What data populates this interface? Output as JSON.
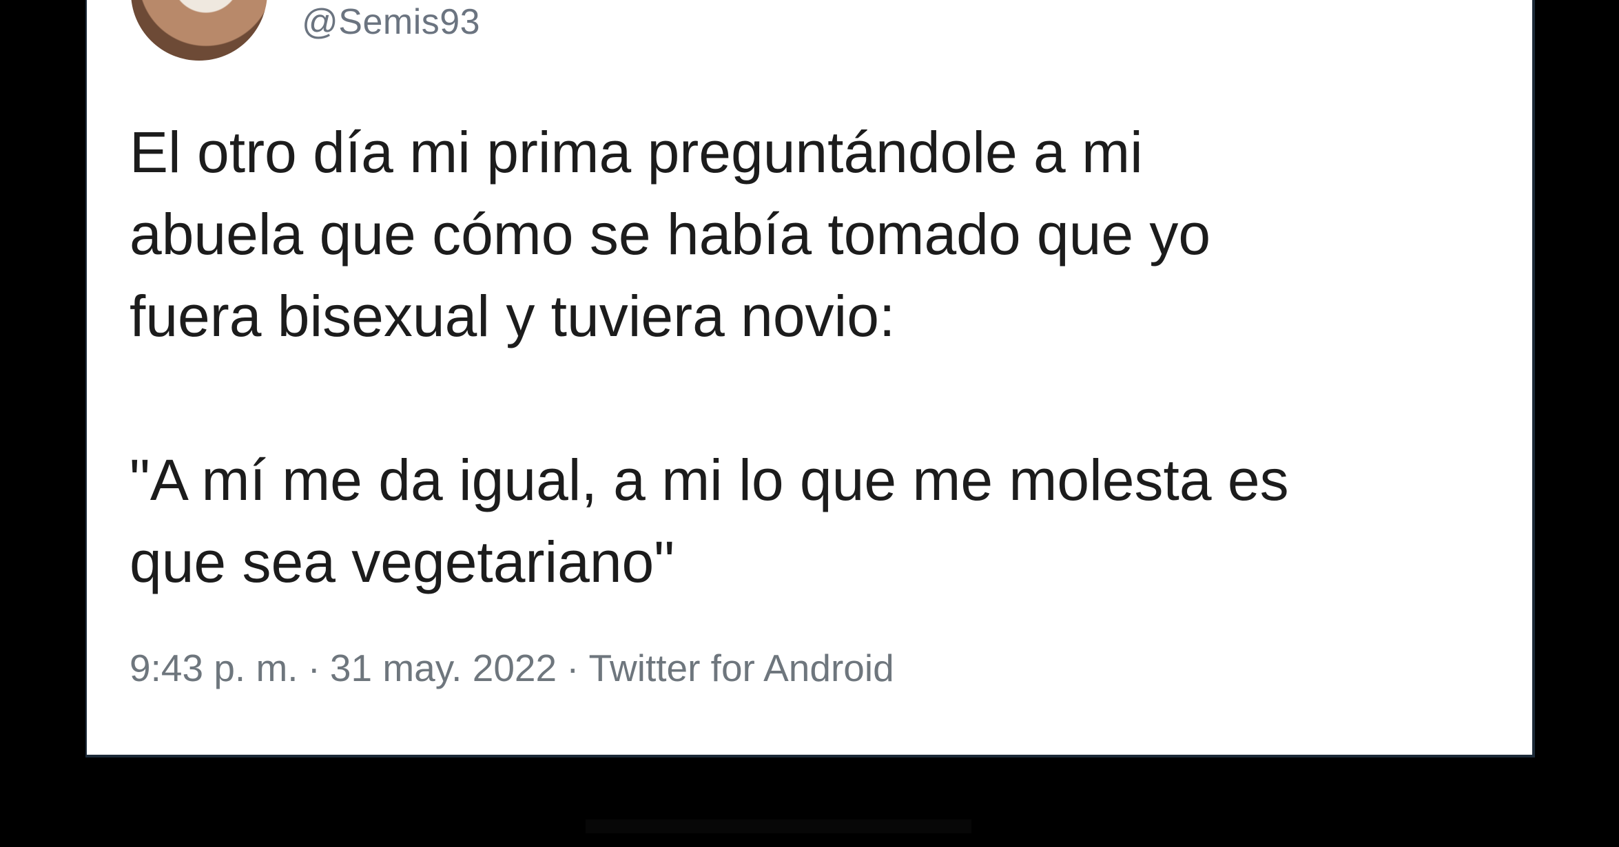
{
  "tweet": {
    "handle": "@Semis93",
    "text": "El otro día mi prima preguntándole a mi\nabuela que cómo se había tomado que yo\nfuera bisexual y tuviera novio:\n\n\"A mí me da igual, a mi lo que me molesta es\nque sea vegetariano\"",
    "time": "9:43 p. m.",
    "date": "31 may. 2022",
    "source": "Twitter for Android",
    "separator": "·"
  },
  "colors": {
    "background": "#000000",
    "card": "#ffffff",
    "text": "#1c1c1c",
    "muted": "#6e767d"
  }
}
